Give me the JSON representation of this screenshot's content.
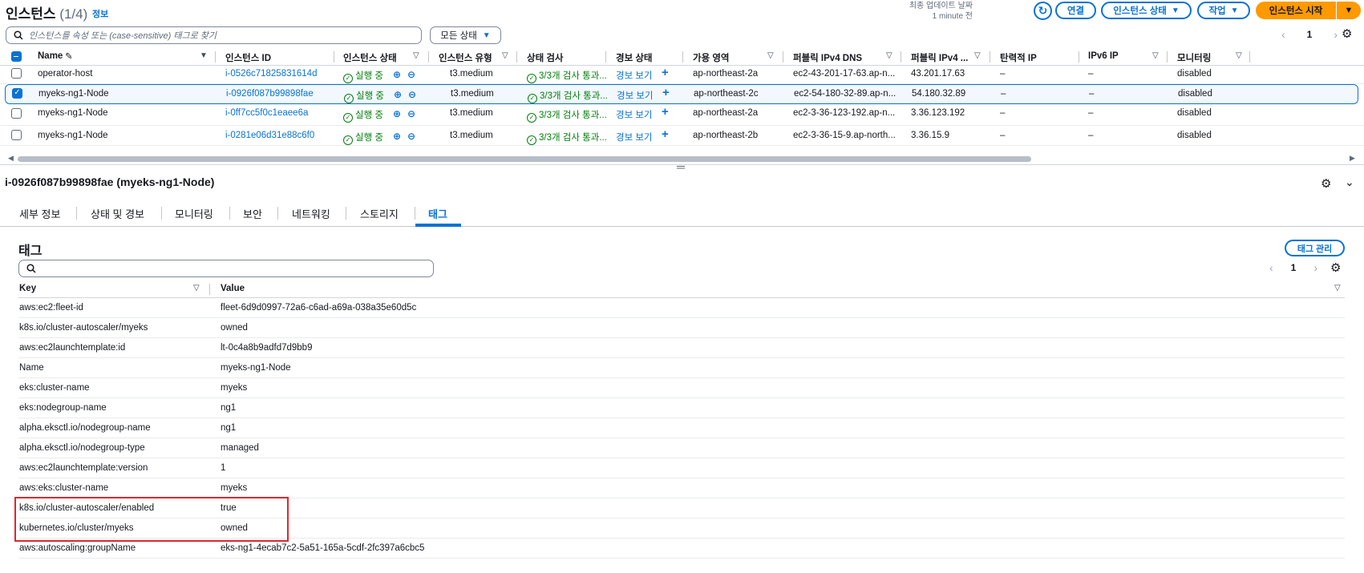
{
  "header": {
    "title": "인스턴스",
    "count": "(1/4)",
    "info_link": "정보",
    "last_updated_label": "최종 업데이트 날짜",
    "last_updated_value": "1 minute 전",
    "connect": "연결",
    "instance_state": "인스턴스 상태",
    "actions": "작업",
    "launch": "인스턴스 시작"
  },
  "search": {
    "placeholder": "인스턴스를 속성 또는 (case-sensitive) 태그로 찾기",
    "state_filter": "모든 상태"
  },
  "pager": {
    "page": "1"
  },
  "columns": {
    "name": "Name",
    "instance_id": "인스턴스 ID",
    "state": "인스턴스 상태",
    "type": "인스턴스 유형",
    "status_check": "상태 검사",
    "alarm": "경보 상태",
    "az": "가용 영역",
    "public_dns": "퍼블릭 IPv4 DNS",
    "public_ip": "퍼블릭 IPv4 ...",
    "elastic_ip": "탄력적 IP",
    "ipv6": "IPv6 IP",
    "monitoring": "모니터링"
  },
  "instances": [
    {
      "name": "operator-host",
      "id": "i-0526c71825831614d",
      "state": "실행 중",
      "type": "t3.medium",
      "check": "3/3개 검사 통과...",
      "alarm": "경보 보기",
      "az": "ap-northeast-2a",
      "dns": "ec2-43-201-17-63.ap-n...",
      "ip": "43.201.17.63",
      "eip": "–",
      "ipv6": "–",
      "mon": "disabled"
    },
    {
      "name": "myeks-ng1-Node",
      "id": "i-0926f087b99898fae",
      "state": "실행 중",
      "type": "t3.medium",
      "check": "3/3개 검사 통과...",
      "alarm": "경보 보기",
      "az": "ap-northeast-2c",
      "dns": "ec2-54-180-32-89.ap-n...",
      "ip": "54.180.32.89",
      "eip": "–",
      "ipv6": "–",
      "mon": "disabled"
    },
    {
      "name": "myeks-ng1-Node",
      "id": "i-0ff7cc5f0c1eaee6a",
      "state": "실행 중",
      "type": "t3.medium",
      "check": "3/3개 검사 통과...",
      "alarm": "경보 보기",
      "az": "ap-northeast-2a",
      "dns": "ec2-3-36-123-192.ap-n...",
      "ip": "3.36.123.192",
      "eip": "–",
      "ipv6": "–",
      "mon": "disabled"
    },
    {
      "name": "myeks-ng1-Node",
      "id": "i-0281e06d31e88c6f0",
      "state": "실행 중",
      "type": "t3.medium",
      "check": "3/3개 검사 통과...",
      "alarm": "경보 보기",
      "az": "ap-northeast-2b",
      "dns": "ec2-3-36-15-9.ap-north...",
      "ip": "3.36.15.9",
      "eip": "–",
      "ipv6": "–",
      "mon": "disabled"
    }
  ],
  "detail": {
    "title": "i-0926f087b99898fae (myeks-ng1-Node)",
    "tabs": [
      "세부 정보",
      "상태 및 경보",
      "모니터링",
      "보안",
      "네트워킹",
      "스토리지",
      "태그"
    ],
    "tags_title": "태그",
    "manage_tags": "태그 관리",
    "page": "1",
    "key_header": "Key",
    "value_header": "Value",
    "tags": [
      {
        "key": "aws:ec2:fleet-id",
        "value": "fleet-6d9d0997-72a6-c6ad-a69a-038a35e60d5c"
      },
      {
        "key": "k8s.io/cluster-autoscaler/myeks",
        "value": "owned"
      },
      {
        "key": "aws:ec2launchtemplate:id",
        "value": "lt-0c4a8b9adfd7d9bb9"
      },
      {
        "key": "Name",
        "value": "myeks-ng1-Node"
      },
      {
        "key": "eks:cluster-name",
        "value": "myeks"
      },
      {
        "key": "eks:nodegroup-name",
        "value": "ng1"
      },
      {
        "key": "alpha.eksctl.io/nodegroup-name",
        "value": "ng1"
      },
      {
        "key": "alpha.eksctl.io/nodegroup-type",
        "value": "managed"
      },
      {
        "key": "aws:ec2launchtemplate:version",
        "value": "1"
      },
      {
        "key": "aws:eks:cluster-name",
        "value": "myeks"
      },
      {
        "key": "k8s.io/cluster-autoscaler/enabled",
        "value": "true"
      },
      {
        "key": "kubernetes.io/cluster/myeks",
        "value": "owned"
      },
      {
        "key": "aws:autoscaling:groupName",
        "value": "eks-ng1-4ecab7c2-5a51-165a-5cdf-2fc397a6cbc5"
      }
    ]
  },
  "colors": {
    "primary": "#0972d3",
    "accent": "#ff9900",
    "success": "#037f0c",
    "highlight": "#e0262d"
  }
}
